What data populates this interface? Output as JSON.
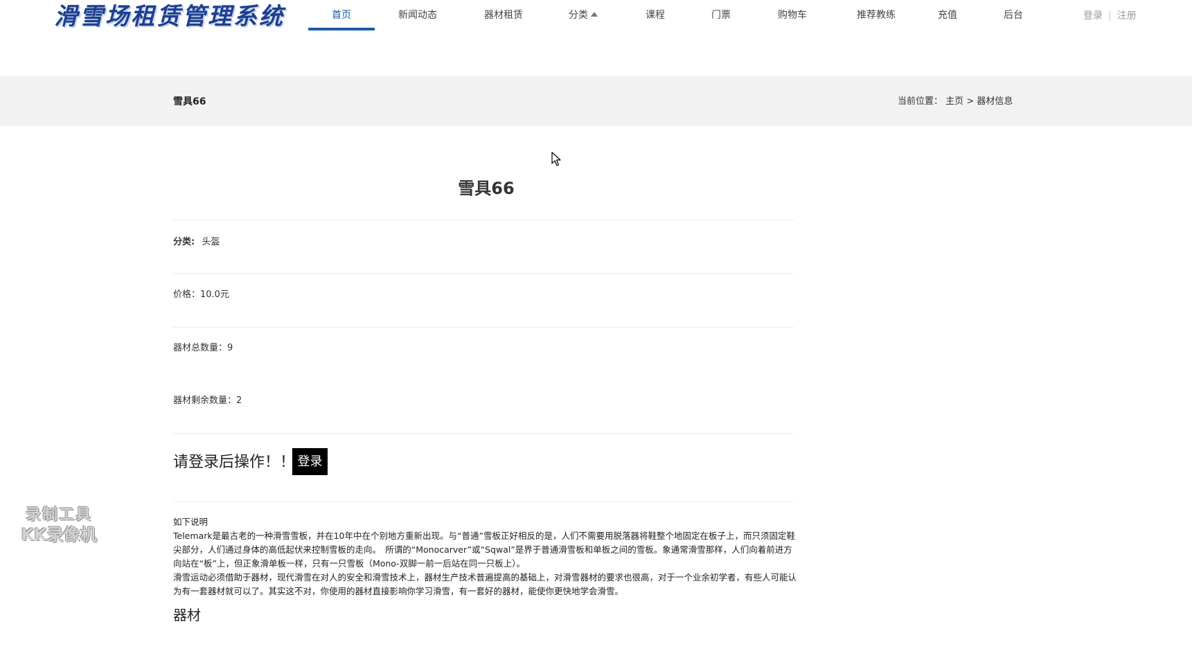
{
  "header": {
    "logo_text": "滑雪场租赁管理系统",
    "nav": [
      {
        "label": "首页",
        "active": true
      },
      {
        "label": "新闻动态"
      },
      {
        "label": "器材租赁"
      },
      {
        "label": "分类"
      },
      {
        "label": "课程"
      },
      {
        "label": "门票"
      },
      {
        "label": "购物车"
      },
      {
        "label": "推荐教练"
      },
      {
        "label": "充值"
      },
      {
        "label": "后台"
      }
    ],
    "login_label": "登录",
    "register_label": "注册"
  },
  "band": {
    "title": "雪具66",
    "breadcrumb": {
      "prefix": "当前位置：",
      "home": "主页",
      "separator": ">",
      "current": "器材信息"
    }
  },
  "item": {
    "title": "雪具66",
    "category_label": "分类:",
    "category_value": "头盔",
    "price_text": "价格：10.0元",
    "total_text": "器材总数量：9",
    "remaining_text": "器材剩余数量：2"
  },
  "login_notice": {
    "message": "请登录后操作！！",
    "button_label": "登录"
  },
  "description": {
    "heading": "如下说明",
    "p1": "Telemark是最古老的一种滑雪雪板，并在10年中在个别地方重新出现。与“普通”雪板正好相反的是，人们不需要用脱落器将鞋整个地固定在板子上，而只须固定鞋尖部分，人们通过身体的高低起伏来控制雪板的走向。　所谓的“Monocarver”或“Sqwal”是界于普通滑雪板和单板之间的雪板。象通常滑雪那样，人们向着前进方向站在“板”上，但正象滑单板一样，只有一只雪板（Mono-双脚一前一后站在同一只板上）。",
    "p2": "滑雪运动必须借助于器材，现代滑雪在对人的安全和滑雪技术上，器材生产技术普遍提高的基础上，对滑雪器材的要求也很高，对于一个业余初学者，有些人可能认为有一套器材就可以了。其实这不对，你使用的器材直接影响你学习滑雪，有一套好的器材，能使你更快地学会滑雪。",
    "section_title": "器材"
  },
  "watermark": {
    "line1": "录制工具",
    "line2": "KK录像机"
  }
}
